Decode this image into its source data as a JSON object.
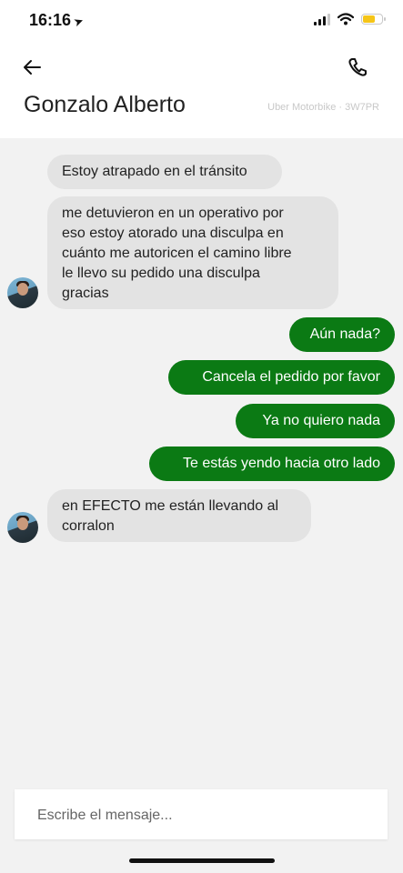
{
  "status_bar": {
    "time": "16:16"
  },
  "header": {
    "contact_name": "Gonzalo Alberto",
    "trip_info": "Uber Motorbike · 3W7PR"
  },
  "messages": [
    {
      "direction": "incoming",
      "text": "Estoy atrapado en el tránsito"
    },
    {
      "direction": "incoming",
      "text": "me detuvieron en un operativo por\neso estoy atorado una disculpa en\ncuánto me autoricen el camino libre\nle llevo su pedido una disculpa\ngracias"
    },
    {
      "direction": "outgoing",
      "text": "Aún nada?"
    },
    {
      "direction": "outgoing",
      "text": "Cancela el pedido por favor"
    },
    {
      "direction": "outgoing",
      "text": "Ya no quiero nada"
    },
    {
      "direction": "outgoing",
      "text": "Te estás yendo hacia otro lado"
    },
    {
      "direction": "incoming",
      "text": "en EFECTO me están llevando al\ncorralon"
    }
  ],
  "composer": {
    "placeholder": "Escribe el mensaje..."
  },
  "colors": {
    "outgoing_bubble": "#0b7a14",
    "incoming_bubble": "#e3e3e3",
    "background": "#f2f2f2"
  }
}
